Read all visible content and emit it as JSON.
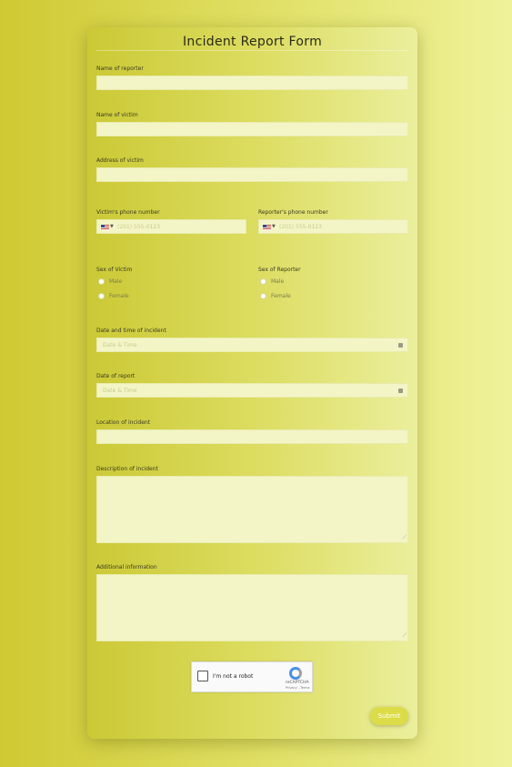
{
  "form": {
    "title": "Incident Report Form",
    "fields": {
      "reporter_name": {
        "label": "Name of reporter",
        "value": ""
      },
      "victim_name": {
        "label": "Name of victim",
        "value": ""
      },
      "victim_address": {
        "label": "Address of victim",
        "value": ""
      },
      "victim_phone": {
        "label": "Victim's phone number",
        "placeholder": "(201) 555-0123"
      },
      "reporter_phone": {
        "label": "Reporter's phone number",
        "placeholder": "(201) 555-0123"
      },
      "victim_sex": {
        "label": "Sex of Victim",
        "options": [
          "Male",
          "Female"
        ]
      },
      "reporter_sex": {
        "label": "Sex of Reporter",
        "options": [
          "Male",
          "Female"
        ]
      },
      "incident_datetime": {
        "label": "Date and time of incident",
        "placeholder": "Date & Time"
      },
      "report_date": {
        "label": "Date of report",
        "placeholder": "Date & Time"
      },
      "incident_location": {
        "label": "Location of incident",
        "value": ""
      },
      "incident_description": {
        "label": "Description of incident",
        "value": ""
      },
      "additional_info": {
        "label": "Additional information",
        "value": ""
      }
    },
    "captcha": {
      "text": "I'm not a robot",
      "brand": "reCAPTCHA",
      "terms": "Privacy - Terms"
    },
    "submit_label": "Submit"
  },
  "colors": {
    "background_from": "#cfc933",
    "background_to": "#eff29a",
    "field_bg": "#f4f5c6",
    "submit_bg": "#dcdc48"
  }
}
